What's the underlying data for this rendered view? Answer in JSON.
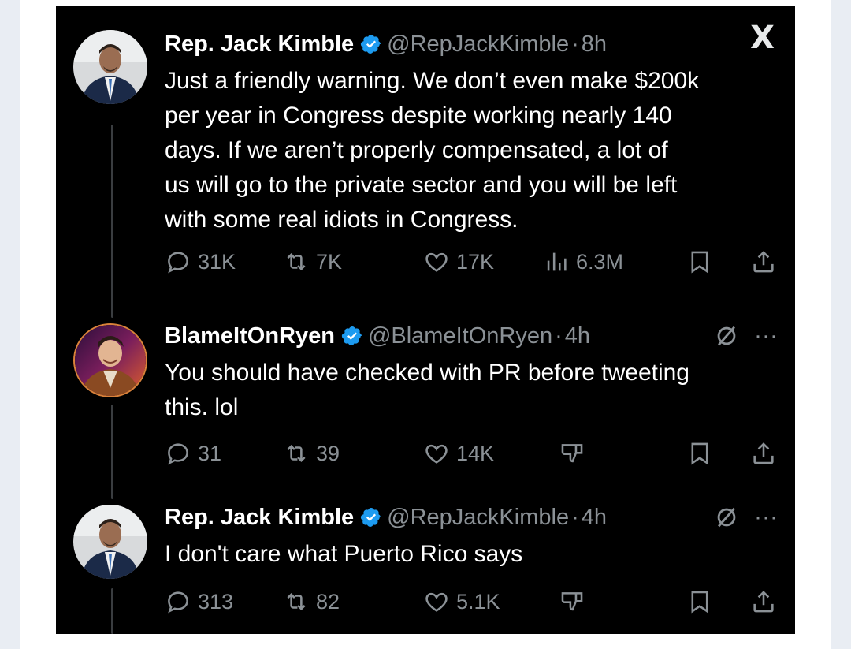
{
  "tweets": [
    {
      "name": "Rep. Jack Kimble",
      "handle": "@RepJackKimble",
      "time": "8h",
      "text": "Just a friendly warning. We don’t even make $200k\nper year in Congress despite working nearly 140\ndays.  If we aren’t properly compensated, a lot of\nus will go to the private sector and you will be left\nwith some real idiots in Congress.",
      "stats": {
        "replies": "31K",
        "retweets": "7K",
        "likes": "17K",
        "views": "6.3M"
      },
      "corner_icon": "x-logo-icon",
      "x_glyph": "X"
    },
    {
      "name": "BlameItOnRyen",
      "handle": "@BlameItOnRyen",
      "time": "4h",
      "text": "You should have checked with PR before tweeting\nthis. lol",
      "stats": {
        "replies": "31",
        "retweets": "39",
        "likes": "14K"
      },
      "corner_icons": [
        "grok-icon",
        "more-icon"
      ],
      "more_glyph": "···"
    },
    {
      "name": "Rep. Jack Kimble",
      "handle": "@RepJackKimble",
      "time": "4h",
      "text": "I don't care what Puerto Rico says",
      "stats": {
        "replies": "313",
        "retweets": "82",
        "likes": "5.1K"
      },
      "corner_icons": [
        "grok-icon",
        "more-icon"
      ],
      "more_glyph": "···"
    }
  ],
  "separator": "·",
  "colors": {
    "background": "#000000",
    "text": "#ffffff",
    "muted": "#8b9196",
    "verified": "#1d9bf0"
  }
}
